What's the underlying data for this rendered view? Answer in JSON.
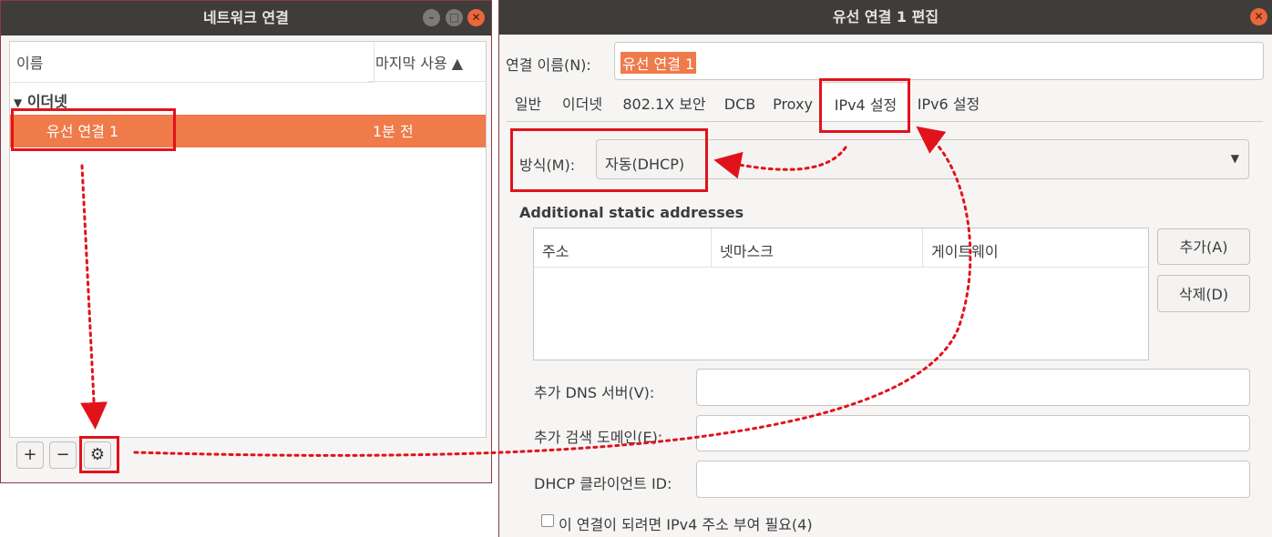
{
  "left_window": {
    "title": "네트워크 연결",
    "columns": [
      "이름",
      "마지막 사용 ▲"
    ],
    "group": "이더넷",
    "rows": [
      {
        "name": "유선 연결 1",
        "last_used": "1분 전"
      }
    ],
    "buttons": {
      "add": "+",
      "remove": "−",
      "settings": "⚙"
    }
  },
  "right_window": {
    "title": "유선 연결 1 편집",
    "connection_name_label": "연결 이름(N):",
    "connection_name_value": "유선 연결 1",
    "tabs": [
      "일반",
      "이더넷",
      "802.1X 보안",
      "DCB",
      "Proxy",
      "IPv4 설정",
      "IPv6 설정"
    ],
    "active_tab": "IPv4 설정",
    "method_label": "방식(M):",
    "method_value": "자동(DHCP)",
    "additional_static_addresses": "Additional static addresses",
    "address_columns": [
      "주소",
      "넷마스크",
      "게이트웨이"
    ],
    "add_button": "추가(A)",
    "delete_button": "삭제(D)",
    "dns_label": "추가 DNS 서버(V):",
    "search_domain_label": "추가 검색 도메인(E):",
    "dhcp_client_id_label": "DHCP 클라이언트 ID:",
    "require_ipv4_checkbox": "이 연결이 되려면 IPv4 주소 부여 필요(4)"
  },
  "colors": {
    "titlebar": "#3f3d3a",
    "selection": "#ef7a4a",
    "annotation": "#e2121b"
  }
}
